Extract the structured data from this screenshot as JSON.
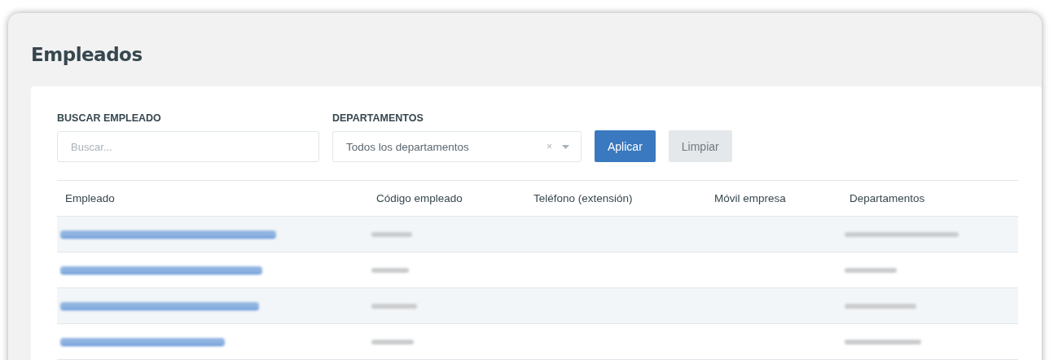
{
  "page": {
    "title": "Empleados"
  },
  "filters": {
    "search_label": "BUSCAR EMPLEADO",
    "search_placeholder": "Buscar...",
    "department_label": "DEPARTAMENTOS",
    "department_value": "Todos los departamentos",
    "clear_icon": "×"
  },
  "buttons": [
    {
      "label": "Aplicar",
      "kind": "primary"
    },
    {
      "label": "Limpiar",
      "kind": "secondary"
    }
  ],
  "table": {
    "columns": [
      "Empleado",
      "Código empleado",
      "Teléfono (extensión)",
      "Móvil empresa",
      "Departamentos"
    ],
    "rows": [
      {
        "kind": "redacted"
      },
      {
        "kind": "redacted"
      },
      {
        "kind": "redacted"
      },
      {
        "kind": "redacted"
      }
    ]
  }
}
